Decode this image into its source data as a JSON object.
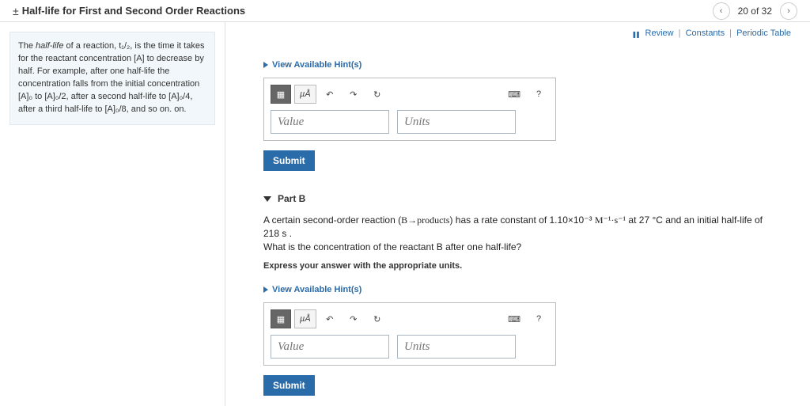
{
  "header": {
    "prefix": "±",
    "title": "Half-life for First and Second Order Reactions",
    "page_label": "20 of 32"
  },
  "toplinks": {
    "review": "Review",
    "constants": "Constants",
    "periodic": "Periodic Table"
  },
  "intro": {
    "line1a": "The ",
    "line1b": "half-life",
    "line1c": " of a reaction, ",
    "t12": "t₁/₂",
    "line1d": ", is the time it takes for the reactant concentration ",
    "A": "[A]",
    "line1e": " to decrease by half. For example, after one half-life the concentration falls from the initial concentration ",
    "A0": "[A]₀",
    "to": " to ",
    "A02": "[A]₀/2",
    "line2": ", after a second half-life to ",
    "A04": "[A]₀/4",
    "line3": ", after a third half-life to ",
    "A08": "[A]₀/8",
    "line4": ", and so on. on."
  },
  "hints_label": "View Available Hint(s)",
  "tool": {
    "grid": "▦",
    "ua": "µÅ",
    "undo": "↶",
    "redo": "↷",
    "reset": "↻",
    "kbd": "⌨",
    "help": "?"
  },
  "fields": {
    "value_ph": "Value",
    "units_ph": "Units"
  },
  "submit_label": "Submit",
  "partB": {
    "heading": "Part B",
    "q1": "A certain second-order reaction (",
    "rxn": "B→products",
    "q2": ") has a rate constant of 1.10×10⁻³ ",
    "unitM": "M⁻¹·s⁻¹",
    "q3": " at 27 °C and an initial half-life of 218 s .",
    "q4": "What is the concentration of the reactant B after one half-life?",
    "instr": "Express your answer with the appropriate units."
  }
}
